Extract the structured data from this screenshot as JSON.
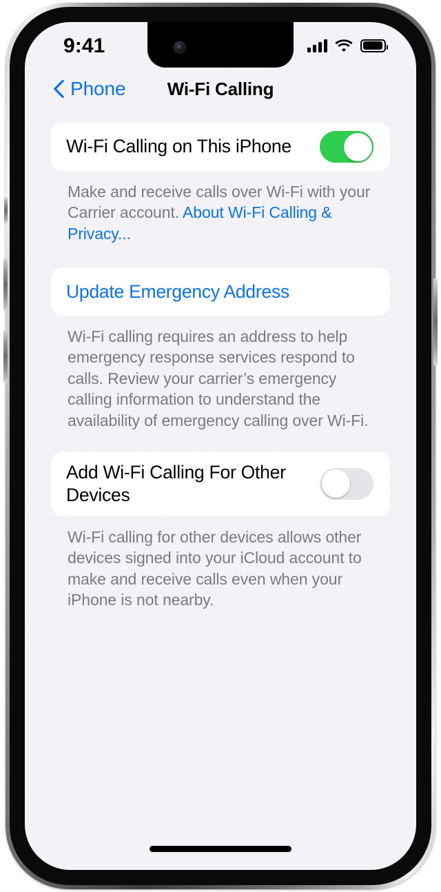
{
  "status_bar": {
    "time": "9:41",
    "cellular_icon": "cellular-bars-icon",
    "cellular_bars": 4,
    "wifi_icon": "wifi-icon",
    "battery_icon": "battery-icon",
    "battery_level_percent": 86
  },
  "nav": {
    "back_icon": "chevron-left-icon",
    "back_label": "Phone",
    "title": "Wi-Fi Calling"
  },
  "sections": [
    {
      "row_label": "Wi-Fi Calling on This iPhone",
      "toggle_state": "on",
      "footnote_text": "Make and receive calls over Wi-Fi with your Carrier account. ",
      "footnote_link": "About Wi-Fi Calling & Privacy..."
    },
    {
      "row_label": "Update Emergency Address",
      "footnote_text": "Wi-Fi calling requires an address to help emergency response services respond to calls. Review your carrier’s emergency calling information to understand the availability of emergency calling over Wi-Fi."
    },
    {
      "row_label": "Add Wi-Fi Calling For Other Devices",
      "toggle_state": "off",
      "footnote_text": "Wi-Fi calling for other devices allows other devices signed into your iCloud account to make and receive calls even when your iPhone is not nearby."
    }
  ],
  "colors": {
    "accent_blue": "#0a72f5",
    "toggle_on_green": "#2fce4e",
    "toggle_off_gray": "#e4e4e9",
    "screen_background": "#f2f2f7",
    "card_background": "#ffffff",
    "footnote_text": "#7a7a80"
  },
  "home_indicator": "home-indicator"
}
